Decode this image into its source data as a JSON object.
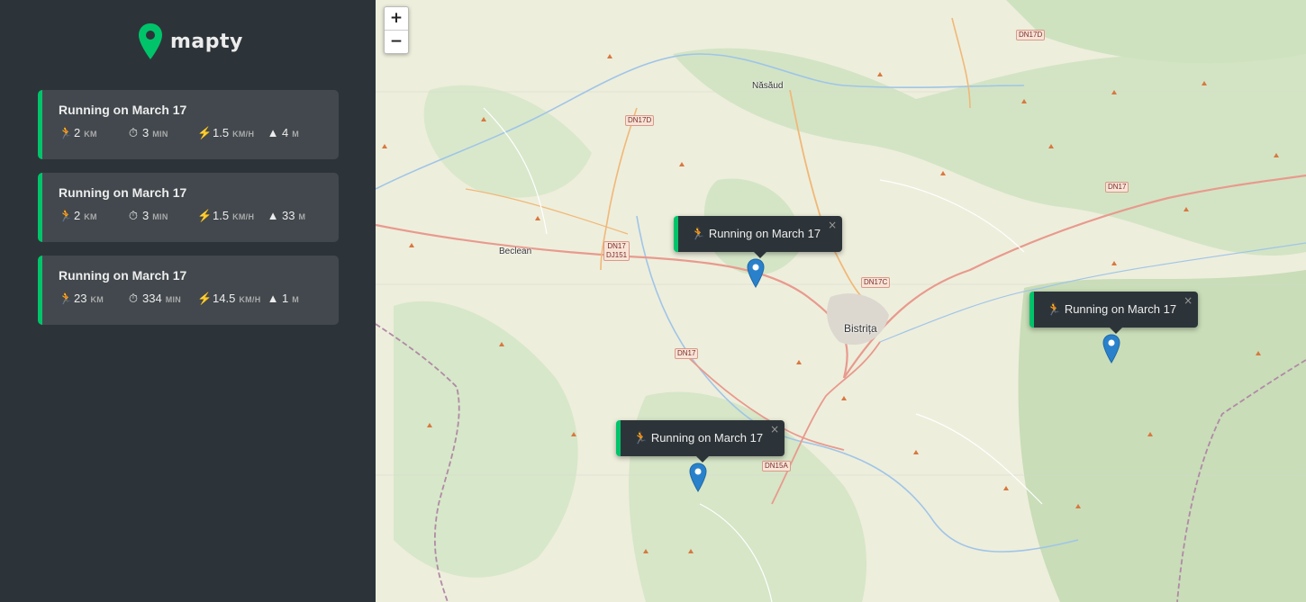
{
  "app": {
    "name": "mapty",
    "accent": "#00c46a"
  },
  "workouts": [
    {
      "title": "Running on March 17",
      "type_icon": "runner",
      "distance": "2",
      "distance_unit": "km",
      "duration": "3",
      "duration_unit": "min",
      "pace": "1.5",
      "pace_unit": "km/h",
      "elevation": "4",
      "elevation_unit": "m"
    },
    {
      "title": "Running on March 17",
      "type_icon": "runner",
      "distance": "2",
      "distance_unit": "km",
      "duration": "3",
      "duration_unit": "min",
      "pace": "1.5",
      "pace_unit": "km/h",
      "elevation": "33",
      "elevation_unit": "m"
    },
    {
      "title": "Running on March 17",
      "type_icon": "runner",
      "distance": "23",
      "distance_unit": "km",
      "duration": "334",
      "duration_unit": "min",
      "pace": "14.5",
      "pace_unit": "km/h",
      "elevation": "1",
      "elevation_unit": "m"
    }
  ],
  "map": {
    "zoom_in": "+",
    "zoom_out": "−",
    "places": {
      "nasaud": "Năsăud",
      "beclean": "Beclean",
      "bistrita": "Bistrița"
    },
    "roads": {
      "dn17d_top": "DN17D",
      "dn17d": "DN17D",
      "dn17_right": "DN17",
      "dn17_dj151_a": "DN17",
      "dn17_dj151_b": "DJ151",
      "dn17c": "DN17C",
      "dn17_center": "DN17",
      "dn15a": "DN15A"
    },
    "popups": [
      {
        "icon": "🏃",
        "text": "Running on March 17",
        "close": "×"
      },
      {
        "icon": "🏃",
        "text": "Running on March 17",
        "close": "×"
      },
      {
        "icon": "🏃",
        "text": "Running on March 17",
        "close": "×"
      }
    ]
  }
}
